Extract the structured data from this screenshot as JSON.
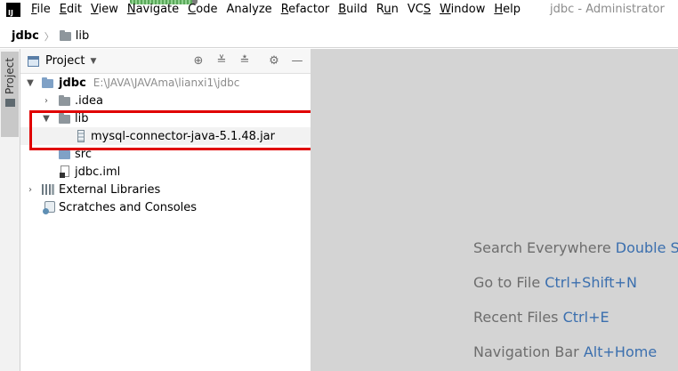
{
  "menubar": {
    "logo": "IJ",
    "items": [
      {
        "label": "File",
        "mnemonic": "F"
      },
      {
        "label": "Edit",
        "mnemonic": "E"
      },
      {
        "label": "View",
        "mnemonic": "V"
      },
      {
        "label": "Navigate",
        "mnemonic": "N"
      },
      {
        "label": "Code",
        "mnemonic": "C"
      },
      {
        "label": "Analyze",
        "mnemonic": ""
      },
      {
        "label": "Refactor",
        "mnemonic": "R"
      },
      {
        "label": "Build",
        "mnemonic": "B"
      },
      {
        "label": "Run",
        "mnemonic": "u"
      },
      {
        "label": "VCS",
        "mnemonic": "S"
      },
      {
        "label": "Window",
        "mnemonic": "W"
      },
      {
        "label": "Help",
        "mnemonic": "H"
      }
    ],
    "window_title": "jdbc - Administrator"
  },
  "breadcrumb": {
    "root": "jdbc",
    "child": "lib"
  },
  "toolstrip": {
    "project_tab_label": "Project"
  },
  "project_panel": {
    "title": "Project",
    "tree": [
      {
        "label": "jdbc",
        "hint": "E:\\JAVA\\JAVAma\\lianxi1\\jdbc",
        "expanded": true
      },
      {
        "label": ".idea",
        "expanded": false
      },
      {
        "label": "lib",
        "expanded": true
      },
      {
        "label": "mysql-connector-java-5.1.48.jar"
      },
      {
        "label": "src"
      },
      {
        "label": "jdbc.iml"
      },
      {
        "label": "External Libraries",
        "expanded": false
      },
      {
        "label": "Scratches and Consoles"
      }
    ]
  },
  "editor_hints": [
    {
      "text": "Search Everywhere",
      "shortcut": "Double Shi"
    },
    {
      "text": "Go to File",
      "shortcut": "Ctrl+Shift+N"
    },
    {
      "text": "Recent Files",
      "shortcut": "Ctrl+E"
    },
    {
      "text": "Navigation Bar",
      "shortcut": "Alt+Home"
    }
  ],
  "colors": {
    "highlight_box": "#e00000",
    "shortcut_blue": "#3b6fae",
    "editor_bg": "#d4d4d4"
  }
}
